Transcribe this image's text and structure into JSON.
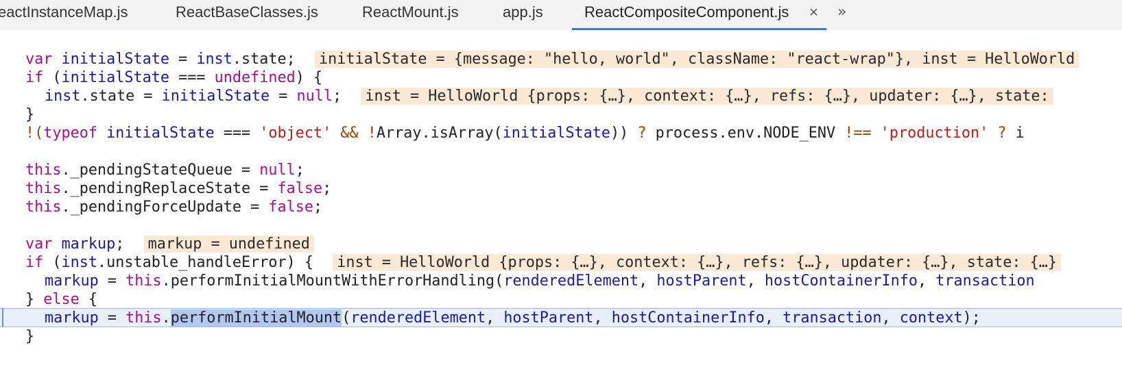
{
  "tabs": [
    {
      "label": "eactInstanceMap.js",
      "active": false
    },
    {
      "label": "ReactBaseClasses.js",
      "active": false
    },
    {
      "label": "ReactMount.js",
      "active": false
    },
    {
      "label": "app.js",
      "active": false
    },
    {
      "label": "ReactCompositeComponent.js",
      "active": true
    }
  ],
  "tab_close_glyph": "×",
  "tab_overflow_glyph": "»",
  "colors": {
    "keyword": "#aa0d91",
    "identifier": "#1a1aa6",
    "string": "#c41a16",
    "inline_value_bg": "#fbe8d5",
    "current_line_bg": "#e7effb",
    "active_tab_underline": "#3879d9"
  },
  "code": {
    "l1": {
      "kw": "var",
      "name": "initialState",
      "eq": " = ",
      "obj": "inst",
      "rest": ".state;",
      "hint": "initialState = {message: \"hello, world\", className: \"react-wrap\"}, inst = HelloWorld"
    },
    "l2": {
      "kw": "if",
      "open": " (",
      "name": "initialState",
      "op": " === ",
      "val": "undefined",
      "close": ") {"
    },
    "l3": {
      "obj": "inst",
      "mid": ".state = ",
      "name": "initialState",
      "eq": " = ",
      "val": "null",
      "end": ";",
      "hint": "inst = HelloWorld {props: {…}, context: {…}, refs: {…}, updater: {…}, state:"
    },
    "l4": {
      "text": "}"
    },
    "l5": {
      "bang": "!(",
      "kw": "typeof",
      "name": "initialState",
      "op": " === ",
      "str": "'object'",
      "and": " && ",
      "bang2": "!",
      "arr": "Array.isArray(",
      "name2": "initialState",
      "mid": ")) ",
      "q": "?",
      "env": " process.env.NODE_ENV ",
      "neq": "!==",
      "str2": " 'production'",
      "q2": " ? ",
      "tail": "i"
    },
    "l6": {
      "kw": "this",
      "rest": "._pendingStateQueue = ",
      "val": "null",
      "end": ";"
    },
    "l7": {
      "kw": "this",
      "rest": "._pendingReplaceState = ",
      "val": "false",
      "end": ";"
    },
    "l8": {
      "kw": "this",
      "rest": "._pendingForceUpdate = ",
      "val": "false",
      "end": ";"
    },
    "l9": {
      "kw": "var",
      "name": "markup",
      "end": ";",
      "hint": "markup = undefined"
    },
    "l10": {
      "kw": "if",
      "open": " (",
      "obj": "inst",
      "rest": ".unstable_handleError) {",
      "hint": "inst = HelloWorld {props: {…}, context: {…}, refs: {…}, updater: {…}, state: {…}"
    },
    "l11": {
      "name": "markup",
      "eq": " = ",
      "kw": "this",
      "call": ".performInitialMountWithErrorHandling(",
      "a1": "renderedElement",
      "c1": ", ",
      "a2": "hostParent",
      "c2": ", ",
      "a3": "hostContainerInfo",
      "c3": ", ",
      "a4": "transaction"
    },
    "l12": {
      "close": "} ",
      "kw": "else",
      "open": " {"
    },
    "l13": {
      "name": "markup",
      "eq": " = ",
      "kw": "this",
      "dot": ".",
      "fn": "performInitialMount",
      "paren": "(",
      "a1": "renderedElement",
      "c1": ", ",
      "a2": "hostParent",
      "c2": ", ",
      "a3": "hostContainerInfo",
      "c3": ", ",
      "a4": "transaction",
      "c4": ", ",
      "a5": "context",
      "end": ");"
    },
    "l14": {
      "text": "}"
    }
  }
}
